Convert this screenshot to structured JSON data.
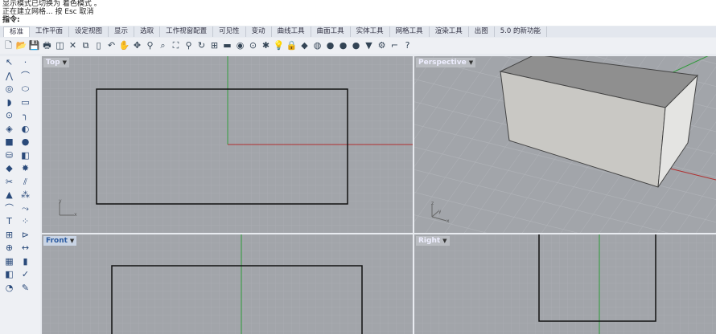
{
  "command": {
    "history": [
      "显示模式已切换为 着色模式 。",
      "正在建立网格... 按 Esc 取消"
    ],
    "prompt": "指令:"
  },
  "tabs": [
    "标准",
    "工作平面",
    "设定视图",
    "显示",
    "选取",
    "工作视窗配置",
    "可见性",
    "变动",
    "曲线工具",
    "曲面工具",
    "实体工具",
    "网格工具",
    "渲染工具",
    "出图",
    "5.0 的新功能"
  ],
  "active_tab": "标准",
  "toolbar_icons": [
    [
      "new-icon",
      "🗋"
    ],
    [
      "open-icon",
      "📂"
    ],
    [
      "save-icon",
      "💾"
    ],
    [
      "print-icon",
      "🖶"
    ],
    [
      "import-icon",
      "◫"
    ],
    [
      "cut-icon",
      "✕"
    ],
    [
      "copy-icon",
      "⧉"
    ],
    [
      "paste-icon",
      "▯"
    ],
    [
      "undo-icon",
      "↶"
    ],
    [
      "pan-icon",
      "✋"
    ],
    [
      "rotate-icon",
      "✥"
    ],
    [
      "zoom-icon",
      "⚲"
    ],
    [
      "zoom-window-icon",
      "⌕"
    ],
    [
      "zoom-extents-icon",
      "⛶"
    ],
    [
      "zoom-selected-icon",
      "⚲"
    ],
    [
      "rotate-view-icon",
      "↻"
    ],
    [
      "viewport-layout-icon",
      "⊞"
    ],
    [
      "cplane-icon",
      "▬"
    ],
    [
      "hide-icon",
      "◉"
    ],
    [
      "show-icon",
      "⊙"
    ],
    [
      "select-icon",
      "✱"
    ],
    [
      "light-icon",
      "💡"
    ],
    [
      "lock-icon",
      "🔒"
    ],
    [
      "material-icon",
      "◆"
    ],
    [
      "color-wheel-icon",
      "◍"
    ],
    [
      "render-icon",
      "●"
    ],
    [
      "shade-icon",
      "●"
    ],
    [
      "render-preview-icon",
      "●"
    ],
    [
      "filter-icon",
      "▼"
    ],
    [
      "options-icon",
      "⚙"
    ],
    [
      "snap-icon",
      "⌐"
    ],
    [
      "help-icon",
      "?"
    ]
  ],
  "left_icons": [
    [
      "select-arrow-icon",
      "↖"
    ],
    [
      "point-icon",
      "·"
    ],
    [
      "polyline-icon",
      "⋀"
    ],
    [
      "curve-icon",
      "⌒"
    ],
    [
      "circle-icon",
      "◎"
    ],
    [
      "ellipse-icon",
      "⬭"
    ],
    [
      "arc-icon",
      "◗"
    ],
    [
      "rectangle-icon",
      "▭"
    ],
    [
      "circle-tangent-icon",
      "⊙"
    ],
    [
      "fillet-curve-icon",
      "╮"
    ],
    [
      "surface-icon",
      "◈"
    ],
    [
      "surface-patch-icon",
      "◐"
    ],
    [
      "box-icon",
      "■"
    ],
    [
      "sphere-icon",
      "●"
    ],
    [
      "cylinder-icon",
      "⛁"
    ],
    [
      "extrude-icon",
      "◧"
    ],
    [
      "boolean-icon",
      "◆"
    ],
    [
      "explode-icon",
      "✸"
    ],
    [
      "trim-icon",
      "✂"
    ],
    [
      "split-icon",
      "⫽"
    ],
    [
      "mesh-icon",
      "▲"
    ],
    [
      "mesh-tools-icon",
      "⁂"
    ],
    [
      "offset-icon",
      "⌒"
    ],
    [
      "extend-icon",
      "⤳"
    ],
    [
      "transform-icon",
      "T"
    ],
    [
      "array-icon",
      "⁘"
    ],
    [
      "group-icon",
      "⊞"
    ],
    [
      "mirror-icon",
      "⊳"
    ],
    [
      "dimension-icon",
      "⊕"
    ],
    [
      "text-icon",
      "↔"
    ],
    [
      "grid-icon",
      "▦"
    ],
    [
      "layer-icon",
      "▮"
    ],
    [
      "properties-icon",
      "◧"
    ],
    [
      "check-icon",
      "✓"
    ],
    [
      "analyze-icon",
      "◔"
    ],
    [
      "render-icon",
      "✎"
    ]
  ],
  "viewports": {
    "top": "Top",
    "perspective": "Perspective",
    "front": "Front",
    "right": "Right"
  },
  "axis_labels": {
    "x": "x",
    "y": "y",
    "z": "z"
  },
  "colors": {
    "grid_bg": "#a2a5aa",
    "x_axis": "#b03030",
    "y_axis": "#2f9a3a",
    "box_front": "#c9c8c4",
    "box_top": "#8f8f8f",
    "box_side": "#e4e4e2"
  }
}
